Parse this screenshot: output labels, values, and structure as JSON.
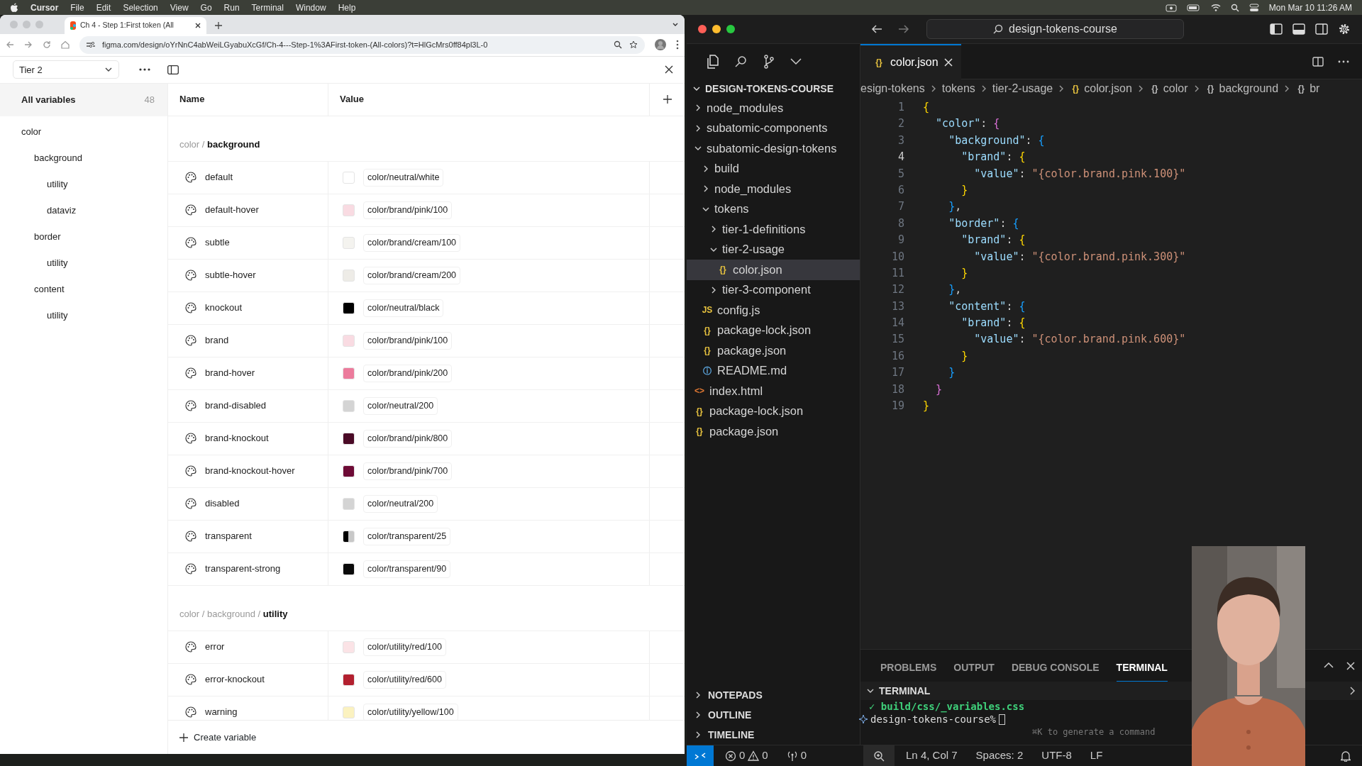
{
  "menubar": {
    "app": "Cursor",
    "items": [
      "File",
      "Edit",
      "Selection",
      "View",
      "Go",
      "Run",
      "Terminal",
      "Window",
      "Help"
    ],
    "clock": "Mon Mar 10  11:26 AM"
  },
  "browser": {
    "tab_title": "Ch 4 - Step 1:First token (All",
    "url": "figma.com/design/oYrNnC4abWeiLGyabuXcGf/Ch-4---Step-1%3AFirst-token-(All-colors)?t=HlGcMrs0ff84pl3L-0"
  },
  "variables": {
    "collection": "Tier 2",
    "all_label": "All variables",
    "count": "48",
    "groups": [
      {
        "label": "color",
        "children": [
          {
            "label": "background",
            "children": [
              {
                "label": "utility"
              },
              {
                "label": "dataviz"
              }
            ]
          },
          {
            "label": "border",
            "children": [
              {
                "label": "utility"
              }
            ]
          },
          {
            "label": "content",
            "children": [
              {
                "label": "utility"
              }
            ]
          }
        ]
      }
    ],
    "columns": [
      "Name",
      "Value"
    ],
    "sections": [
      {
        "title": "color / **background**",
        "rows": [
          {
            "name": "default",
            "value": "color/neutral/white",
            "kind": "solid",
            "color": "#ffffff"
          },
          {
            "name": "default-hover",
            "value": "color/brand/pink/100",
            "kind": "solid",
            "color": "#f9dbe2"
          },
          {
            "name": "subtle",
            "value": "color/brand/cream/100",
            "kind": "solid",
            "color": "#f4f3ef"
          },
          {
            "name": "subtle-hover",
            "value": "color/brand/cream/200",
            "kind": "solid",
            "color": "#eeece7"
          },
          {
            "name": "knockout",
            "value": "color/neutral/black",
            "kind": "solid",
            "color": "#000000"
          },
          {
            "name": "brand",
            "value": "color/brand/pink/100",
            "kind": "solid",
            "color": "#f9dbe2"
          },
          {
            "name": "brand-hover",
            "value": "color/brand/pink/200",
            "kind": "solid",
            "color": "#ec7b9c"
          },
          {
            "name": "brand-disabled",
            "value": "color/neutral/200",
            "kind": "solid",
            "color": "#d4d4d4"
          },
          {
            "name": "brand-knockout",
            "value": "color/brand/pink/800",
            "kind": "solid",
            "color": "#4a0a26"
          },
          {
            "name": "brand-knockout-hover",
            "value": "color/brand/pink/700",
            "kind": "solid",
            "color": "#6e0b36"
          },
          {
            "name": "disabled",
            "value": "color/neutral/200",
            "kind": "solid",
            "color": "#d4d4d4"
          },
          {
            "name": "transparent",
            "value": "color/transparent/25",
            "kind": "split",
            "color": "#000000"
          },
          {
            "name": "transparent-strong",
            "value": "color/transparent/90",
            "kind": "solid",
            "color": "#0a0a0a"
          }
        ]
      },
      {
        "title": "color / background / **utility**",
        "rows": [
          {
            "name": "error",
            "value": "color/utility/red/100",
            "kind": "solid",
            "color": "#fbe3e6"
          },
          {
            "name": "error-knockout",
            "value": "color/utility/red/600",
            "kind": "solid",
            "color": "#b3202f"
          },
          {
            "name": "warning",
            "value": "color/utility/yellow/100",
            "kind": "solid",
            "color": "#fbf2c0"
          }
        ]
      }
    ],
    "create_label": "Create variable"
  },
  "editor": {
    "search": "design-tokens-course",
    "explorer_title": "DESIGN-TOKENS-COURSE",
    "tree": [
      {
        "label": "node_modules",
        "kind": "folder",
        "expanded": false,
        "selected": false
      },
      {
        "label": "subatomic-components",
        "kind": "folder",
        "expanded": false,
        "selected": false
      },
      {
        "label": "subatomic-design-tokens",
        "kind": "folder",
        "expanded": true,
        "selected": false,
        "children": [
          {
            "label": "build",
            "kind": "folder",
            "expanded": false,
            "selected": false
          },
          {
            "label": "node_modules",
            "kind": "folder",
            "expanded": false,
            "selected": false
          },
          {
            "label": "tokens",
            "kind": "folder",
            "expanded": true,
            "selected": false,
            "children": [
              {
                "label": "tier-1-definitions",
                "kind": "folder",
                "expanded": false,
                "selected": false
              },
              {
                "label": "tier-2-usage",
                "kind": "folder",
                "expanded": true,
                "selected": false,
                "children": [
                  {
                    "label": "color.json",
                    "kind": "json",
                    "icon": "{}",
                    "selected": true
                  }
                ]
              },
              {
                "label": "tier-3-component",
                "kind": "folder",
                "expanded": false,
                "selected": false
              }
            ]
          },
          {
            "label": "config.js",
            "kind": "js",
            "icon": "JS",
            "selected": false
          },
          {
            "label": "package-lock.json",
            "kind": "json",
            "icon": "{}",
            "selected": false
          },
          {
            "label": "package.json",
            "kind": "json",
            "icon": "{}",
            "selected": false
          },
          {
            "label": "README.md",
            "kind": "info",
            "icon": "ⓘ",
            "selected": false
          }
        ]
      },
      {
        "label": "index.html",
        "kind": "html",
        "icon": "<>",
        "selected": false
      },
      {
        "label": "package-lock.json",
        "kind": "json",
        "icon": "{}",
        "selected": false
      },
      {
        "label": "package.json",
        "kind": "json",
        "icon": "{}",
        "selected": false
      }
    ],
    "side_sections": [
      "NOTEPADS",
      "OUTLINE",
      "TIMELINE"
    ],
    "tab": "color.json",
    "tab_icon": "{}",
    "breadcrumbs": [
      {
        "kind": "folder",
        "label": "esign-tokens"
      },
      {
        "kind": "folder",
        "label": "tokens"
      },
      {
        "kind": "folder",
        "label": "tier-2-usage"
      },
      {
        "kind": "file",
        "icon": "{}",
        "label": "color.json"
      },
      {
        "kind": "symbol",
        "icon": "{}",
        "label": "color"
      },
      {
        "kind": "symbol",
        "icon": "{}",
        "label": "background"
      },
      {
        "kind": "symbol",
        "icon": "{}",
        "label": "br"
      }
    ],
    "lines": [
      {
        "n": "1",
        "text": "{",
        "current": false
      },
      {
        "n": "2",
        "text": "  \"color\": {",
        "current": false
      },
      {
        "n": "3",
        "text": "    \"background\": {",
        "current": false
      },
      {
        "n": "4",
        "text": "      \"brand\": {",
        "current": true
      },
      {
        "n": "5",
        "text": "        \"value\": \"{color.brand.pink.100}\"",
        "current": false
      },
      {
        "n": "6",
        "text": "      }",
        "current": false
      },
      {
        "n": "7",
        "text": "    },",
        "current": false
      },
      {
        "n": "8",
        "text": "    \"border\": {",
        "current": false
      },
      {
        "n": "9",
        "text": "      \"brand\": {",
        "current": false
      },
      {
        "n": "10",
        "text": "        \"value\": \"{color.brand.pink.300}\"",
        "current": false
      },
      {
        "n": "11",
        "text": "      }",
        "current": false
      },
      {
        "n": "12",
        "text": "    },",
        "current": false
      },
      {
        "n": "13",
        "text": "    \"content\": {",
        "current": false
      },
      {
        "n": "14",
        "text": "      \"brand\": {",
        "current": false
      },
      {
        "n": "15",
        "text": "        \"value\": \"{color.brand.pink.600}\"",
        "current": false
      },
      {
        "n": "16",
        "text": "      }",
        "current": false
      },
      {
        "n": "17",
        "text": "    }",
        "current": false
      },
      {
        "n": "18",
        "text": "  }",
        "current": false
      },
      {
        "n": "19",
        "text": "}",
        "current": false
      }
    ],
    "panel_tabs": [
      {
        "label": "PROBLEMS",
        "selected": false
      },
      {
        "label": "OUTPUT",
        "selected": false
      },
      {
        "label": "DEBUG CONSOLE",
        "selected": false
      },
      {
        "label": "TERMINAL",
        "selected": true
      }
    ],
    "terminal_title": "TERMINAL",
    "terminal_lines": [
      {
        "kind": "success",
        "text": "✓ build/css/_variables.css"
      },
      {
        "kind": "prompt",
        "text": "design-tokens-course%"
      }
    ],
    "terminal_hint": "⌘K to generate a command",
    "status": {
      "errors": "0",
      "warnings": "0",
      "ports": "0",
      "position": "Ln 4, Col 7",
      "spaces": "Spaces: 2",
      "encoding": "UTF-8",
      "eol": "LF"
    }
  }
}
